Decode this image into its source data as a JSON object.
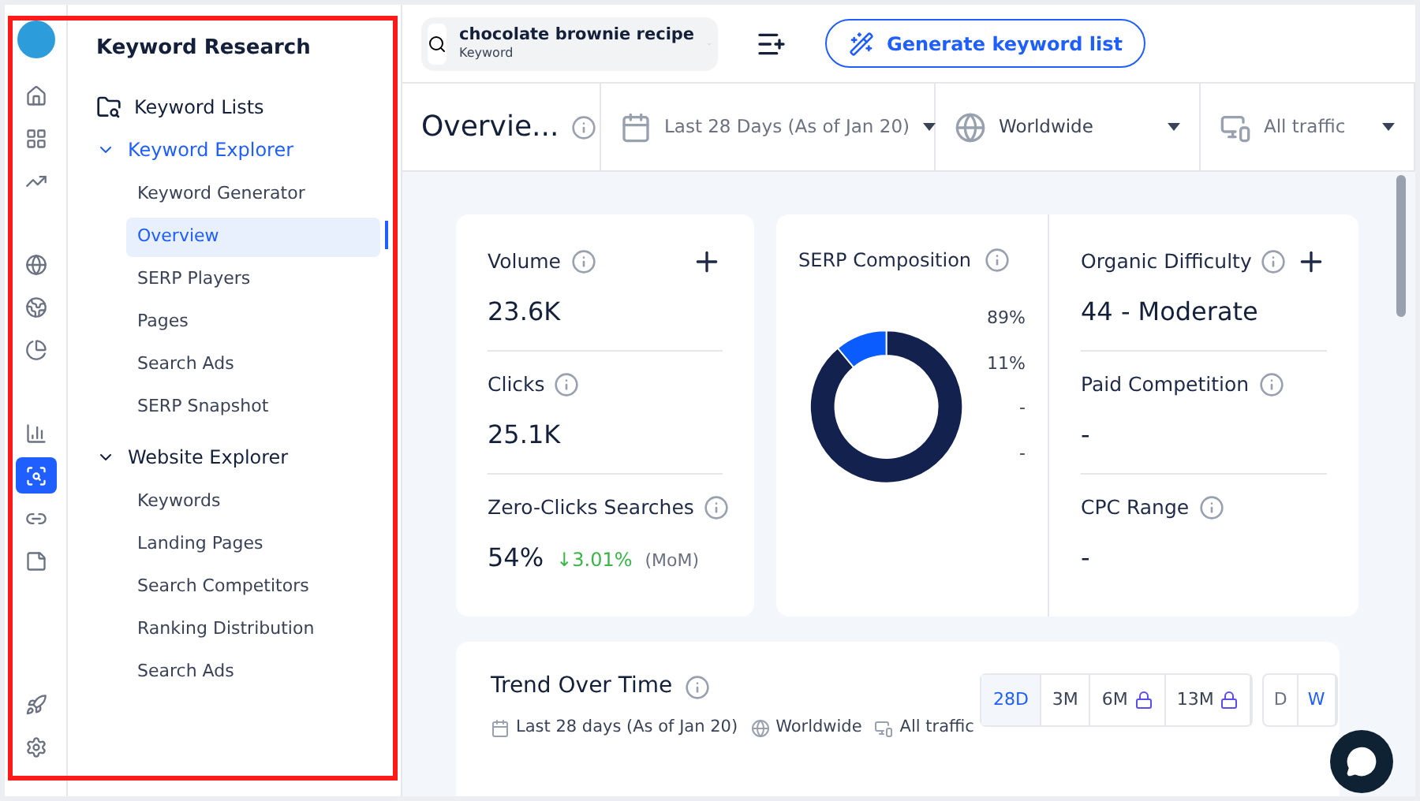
{
  "sidebar": {
    "title": "Keyword Research",
    "rail": [
      {
        "kind": "home",
        "selected": false
      },
      {
        "kind": "apps",
        "selected": false
      },
      {
        "kind": "trend",
        "selected": false
      },
      {
        "kind": "globe",
        "selected": false
      },
      {
        "kind": "globe2",
        "selected": false
      },
      {
        "kind": "pie",
        "selected": false
      },
      {
        "kind": "bars",
        "selected": false
      },
      {
        "kind": "search",
        "selected": true
      },
      {
        "kind": "link",
        "selected": false
      },
      {
        "kind": "note",
        "selected": false
      },
      {
        "kind": "rocket",
        "selected": false
      },
      {
        "kind": "gear",
        "selected": false
      }
    ],
    "items": [
      {
        "label": "Keyword Lists",
        "kind": "list"
      },
      {
        "label": "Keyword Explorer",
        "kind": "group",
        "expanded": true,
        "active": true,
        "children": [
          {
            "label": "Keyword Generator",
            "selected": false
          },
          {
            "label": "Overview",
            "selected": true
          },
          {
            "label": "SERP Players",
            "selected": false
          },
          {
            "label": "Pages",
            "selected": false
          },
          {
            "label": "Search Ads",
            "selected": false
          },
          {
            "label": "SERP Snapshot",
            "selected": false
          }
        ]
      },
      {
        "label": "Website Explorer",
        "kind": "group",
        "expanded": true,
        "active": false,
        "children": [
          {
            "label": "Keywords",
            "selected": false
          },
          {
            "label": "Landing Pages",
            "selected": false
          },
          {
            "label": "Search Competitors",
            "selected": false
          },
          {
            "label": "Ranking Distribution",
            "selected": false
          },
          {
            "label": "Search Ads",
            "selected": false
          }
        ]
      }
    ]
  },
  "search": {
    "value": "chocolate brownie recipe",
    "type": "Keyword"
  },
  "generate_button": "Generate keyword list",
  "page_title": "Overvie...",
  "filters": [
    {
      "kind": "date",
      "label": "Last 28 Days (As of Jan 20)"
    },
    {
      "kind": "globe",
      "label": "Worldwide"
    },
    {
      "kind": "device",
      "label": "All traffic"
    }
  ],
  "metrics_left": [
    {
      "label": "Volume",
      "value": "23.6K",
      "plus": true
    },
    {
      "label": "Clicks",
      "value": "25.1K",
      "plus": false
    },
    {
      "label": "Zero-Clicks Searches",
      "value": "54%",
      "change": "↓3.01%",
      "change_note": "(MoM)",
      "plus": false
    }
  ],
  "serp": {
    "title": "SERP Composition",
    "legend": [
      "89%",
      "11%",
      "-",
      "-"
    ],
    "chart_data": {
      "type": "donut",
      "series": [
        {
          "values": [
            89,
            11
          ]
        }
      ],
      "colors": [
        "#13214f",
        "#0a5cff"
      ]
    }
  },
  "metrics_right": [
    {
      "label": "Organic Difficulty",
      "value": "44 - Moderate",
      "plus": true
    },
    {
      "label": "Paid Competition",
      "value": "-",
      "plus": false
    },
    {
      "label": "CPC Range",
      "value": "-",
      "plus": false
    }
  ],
  "trend": {
    "title": "Trend Over Time",
    "meta": [
      {
        "kind": "date",
        "label": "Last 28 days (As of Jan 20)"
      },
      {
        "kind": "globe",
        "label": "Worldwide"
      },
      {
        "kind": "device",
        "label": "All traffic"
      }
    ],
    "ranges": [
      {
        "label": "28D",
        "selected": true,
        "locked": false
      },
      {
        "label": "3M",
        "selected": false,
        "locked": false
      },
      {
        "label": "6M",
        "selected": false,
        "locked": true
      },
      {
        "label": "13M",
        "selected": false,
        "locked": true
      }
    ],
    "granularity": [
      {
        "label": "D",
        "selected": false
      },
      {
        "label": "W",
        "selected": true
      }
    ]
  }
}
